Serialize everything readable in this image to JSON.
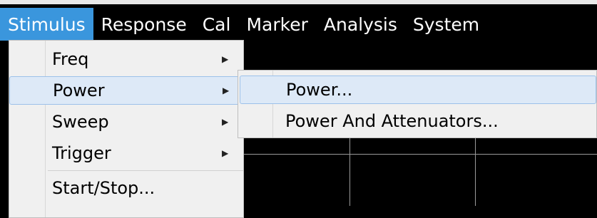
{
  "menubar": {
    "items": [
      {
        "label": "Stimulus",
        "active": true
      },
      {
        "label": "Response"
      },
      {
        "label": "Cal"
      },
      {
        "label": "Marker"
      },
      {
        "label": "Analysis"
      },
      {
        "label": "System"
      }
    ]
  },
  "stimulus_menu": {
    "items": [
      {
        "label": "Freq",
        "has_submenu": true
      },
      {
        "label": "Power",
        "has_submenu": true,
        "highlighted": true
      },
      {
        "label": "Sweep",
        "has_submenu": true
      },
      {
        "label": "Trigger",
        "has_submenu": true
      },
      {
        "label": "Start/Stop..."
      }
    ],
    "arrow_glyph": "▶"
  },
  "power_submenu": {
    "items": [
      {
        "label": "Power...",
        "highlighted": true
      },
      {
        "label": "Power And Attenuators..."
      }
    ]
  },
  "colors": {
    "menubar_bg": "#000000",
    "menubar_active": "#3a96dd",
    "menu_bg": "#f0f0f0",
    "highlight_bg": "#dde9f7",
    "highlight_border": "#9cc1ea",
    "grid": "#9a9a9a"
  }
}
